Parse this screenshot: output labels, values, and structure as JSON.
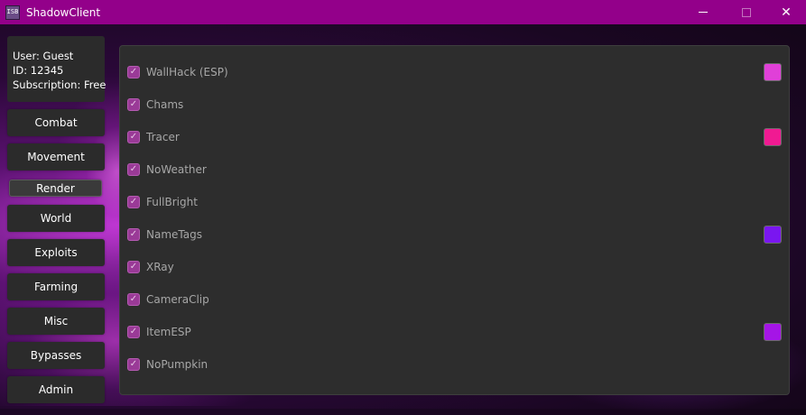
{
  "window": {
    "title": "ShadowClient",
    "icon_text": "ISB",
    "controls": {
      "minimize": "minimize-icon",
      "maximize": "maximize-icon",
      "close": "✕"
    }
  },
  "user": {
    "name_line": "User: Guest",
    "id_line": "ID: 12345",
    "subscription_line": "Subscription: Free"
  },
  "nav": {
    "active": "Render",
    "items": [
      "Combat",
      "Movement",
      "Render",
      "World",
      "Exploits",
      "Farming",
      "Misc",
      "Bypasses",
      "Admin"
    ]
  },
  "features": [
    {
      "label": "WallHack (ESP)",
      "checked": true,
      "color": "#e040d8"
    },
    {
      "label": "Chams",
      "checked": true
    },
    {
      "label": "Tracer",
      "checked": true,
      "color": "#f01a92"
    },
    {
      "label": "NoWeather",
      "checked": true
    },
    {
      "label": "FullBright",
      "checked": true
    },
    {
      "label": "NameTags",
      "checked": true,
      "color": "#7a16f0"
    },
    {
      "label": "XRay",
      "checked": true
    },
    {
      "label": "CameraClip",
      "checked": true
    },
    {
      "label": "ItemESP",
      "checked": true,
      "color": "#a515e6"
    },
    {
      "label": "NoPumpkin",
      "checked": true
    }
  ],
  "theme": {
    "accent": "#93008a",
    "checkbox": "#9a3a97",
    "panel": "#2d2d2d"
  }
}
